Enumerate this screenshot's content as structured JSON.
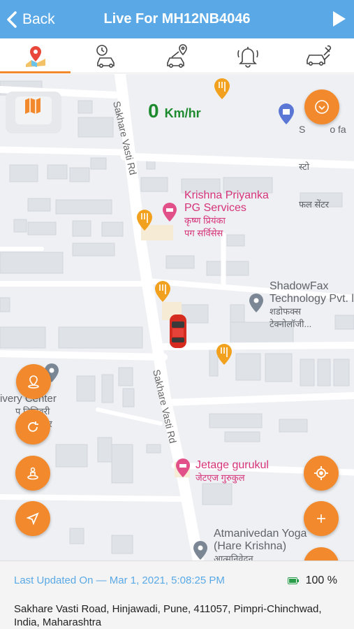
{
  "header": {
    "back_label": "Back",
    "title": "Live For MH12NB4046"
  },
  "tabs": [
    {
      "name": "live-map",
      "active": true
    },
    {
      "name": "trip-history",
      "active": false
    },
    {
      "name": "route-location",
      "active": false
    },
    {
      "name": "alerts",
      "active": false
    },
    {
      "name": "vehicle-service",
      "active": false
    }
  ],
  "map": {
    "speed_value": "0",
    "speed_unit": "Km/hr",
    "roads": {
      "sakhare_upper": "Sakhare Vasti Rd",
      "sakhare_lower": "Sakhare Vasti Rd"
    },
    "pois": {
      "krishna_en_1": "Krishna Priyanka",
      "krishna_en_2": "PG Services",
      "krishna_hi_1": "कृष्ण प्रियंका",
      "krishna_hi_2": "पग सर्विसेस",
      "shadowfax_en_1": "ShadowFax",
      "shadowfax_en_2": "Technology Pvt. l",
      "shadowfax_hi_1": "शडोफक्स",
      "shadowfax_hi_2": "टेक्नोलॉजी...",
      "jetage_en": "Jetage gurukul",
      "jetage_hi": "जेटएज गुरुकुल",
      "atman_en_1": "Atmanivedan Yoga",
      "atman_en_2": "(Hare Krishna)",
      "atman_hi": "आत्मनिवेदन",
      "delivery_en": "ivery Center",
      "delivery_hi_1": "प डिलिवरी",
      "delivery_hi_2": "सेंटर",
      "top_right_en": "S         o fa",
      "top_right_hi_1": "स्टो",
      "top_right_hi_2": "फल सेंटर"
    }
  },
  "footer": {
    "last_updated": "Last Updated On — Mar 1, 2021, 5:08:25 PM",
    "battery": "100 %",
    "address": "Sakhare Vasti Road, Hinjawadi, Pune, 411057, Pimpri-Chinchwad, India, Maharashtra"
  },
  "colors": {
    "accent": "#f28a2d",
    "header": "#5aa9e6",
    "speed": "#1d8a2e",
    "poi_pink": "#d6337a"
  }
}
